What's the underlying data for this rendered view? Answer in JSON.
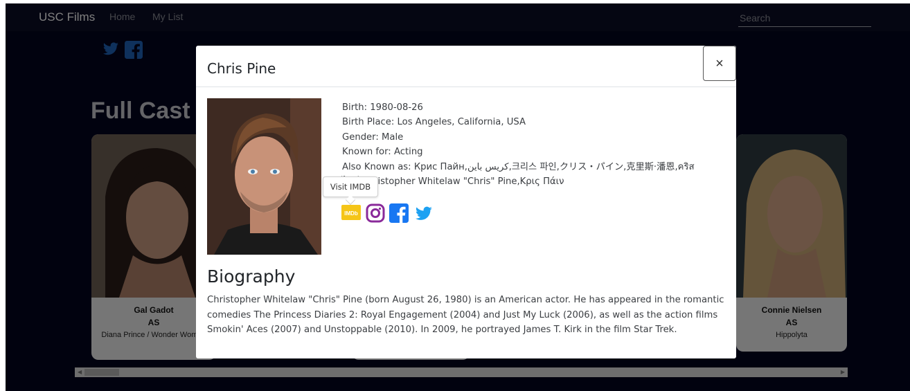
{
  "navbar": {
    "brand": "USC Films",
    "links": [
      "Home",
      "My List"
    ],
    "search_placeholder": "Search"
  },
  "background": {
    "section_heading": "Full Cast",
    "cast": [
      {
        "name": "Gal Gadot",
        "as": "AS",
        "role": "Diana Prince / Wonder Woman"
      },
      {
        "name": "Connie Nielsen",
        "as": "AS",
        "role": "Hippolyta"
      }
    ]
  },
  "modal": {
    "title": "Chris Pine",
    "close_label": "×",
    "info": {
      "birth": "Birth: 1980-08-26",
      "birth_place": "Birth Place: Los Angeles, California, USA",
      "gender": "Gender: Male",
      "known_for": "Known for: Acting",
      "also_known_as": "Also Known as: Крис Пайн,كريس باين,크리스 파인,クリス・パイン,克里斯·潘恩,คริส ไพน์,Christopher Whitelaw \"Chris\" Pine,Κρις Πάιν"
    },
    "tooltip": "Visit IMDB",
    "social_icons": [
      "imdb-icon",
      "instagram-icon",
      "facebook-icon",
      "twitter-icon"
    ],
    "bio_heading": "Biography",
    "bio_text": "Christopher Whitelaw \"Chris\" Pine (born August 26, 1980) is an American actor. He has appeared in the romantic comedies The Princess Diaries 2: Royal Engagement (2004) and Just My Luck (2006), as well as the action films Smokin' Aces (2007) and Unstoppable (2010). In 2009, he portrayed James T. Kirk in the film Star Trek."
  },
  "colors": {
    "page_bg": "#03041f",
    "imdb": "#f5c518",
    "instagram": "#8a2a9a",
    "facebook": "#1877f2",
    "twitter": "#1da1f2"
  }
}
